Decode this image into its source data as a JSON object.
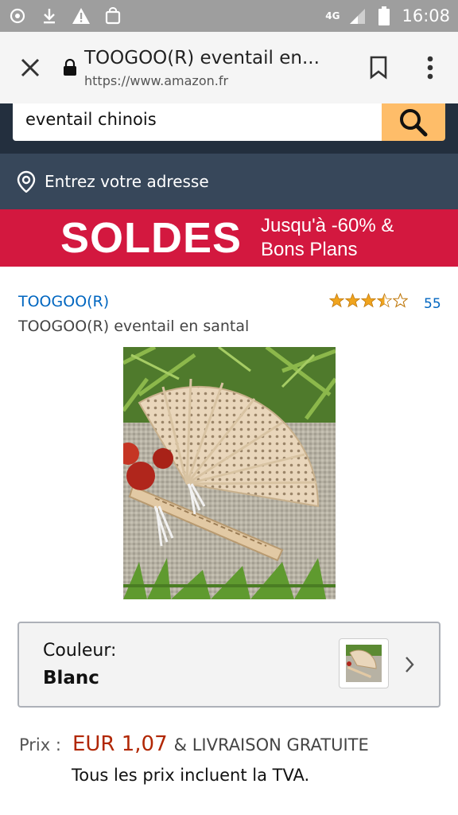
{
  "status_bar": {
    "network": "4G",
    "time": "16:08",
    "icons": [
      "sync-icon",
      "download-icon",
      "warning-icon",
      "shopping-bag-icon",
      "signal-icon",
      "battery-icon"
    ]
  },
  "browser": {
    "title": "TOOGOO(R) eventail en...",
    "url": "https://www.amazon.fr"
  },
  "search": {
    "query": "eventail chinois"
  },
  "address": {
    "label": "Entrez votre adresse"
  },
  "banner": {
    "headline": "SOLDES",
    "line1": "Jusqu'à -60% &",
    "line2": "Bons Plans",
    "color": "#d3183f"
  },
  "product": {
    "brand": "TOOGOO(R)",
    "name": "TOOGOO(R) eventail en santal",
    "rating": 3.5,
    "rating_max": 5,
    "review_count": "55"
  },
  "color_selector": {
    "label": "Couleur:",
    "value": "Blanc"
  },
  "price": {
    "label": "Prix :",
    "amount": "EUR 1,07",
    "shipping": "& LIVRAISON GRATUITE",
    "vat_note": "Tous les prix incluent la TVA.",
    "color": "#b12704"
  },
  "colors": {
    "status_bar": "#9e9e9e",
    "amazon_nav": "#232f3e",
    "address_bar": "#37475a",
    "search_button": "#febd69",
    "link": "#0066c0"
  }
}
